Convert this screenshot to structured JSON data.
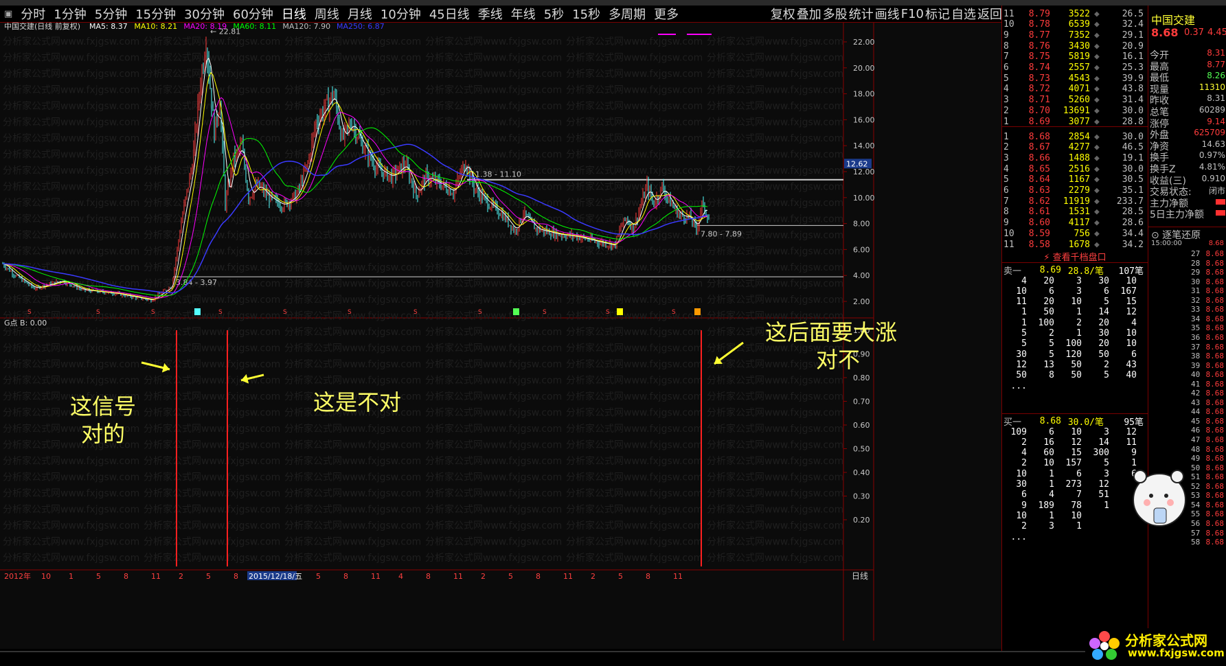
{
  "toolbar": {
    "periods": [
      "分时",
      "1分钟",
      "5分钟",
      "15分钟",
      "30分钟",
      "60分钟",
      "日线",
      "周线",
      "月线",
      "10分钟",
      "45日线",
      "季线",
      "年线",
      "5秒",
      "15秒",
      "多周期",
      "更多"
    ],
    "active": "日线",
    "right_items": [
      "复权",
      "叠加",
      "多股",
      "统计",
      "画线",
      "F10",
      "标记",
      "自选",
      "返回"
    ]
  },
  "main_chart": {
    "title": "中国交建(日线 前复权)",
    "indicators": [
      {
        "label": "MA5: 8.37",
        "color": "#ffffff"
      },
      {
        "label": "MA10: 8.21",
        "color": "#ffff00"
      },
      {
        "label": "MA20: 8.19",
        "color": "#ff00ff"
      },
      {
        "label": "MA60: 8.11",
        "color": "#00ff00"
      },
      {
        "label": "MA120: 7.90",
        "color": "#c0c0c0"
      },
      {
        "label": "MA250: 6.87",
        "color": "#3a3aff"
      }
    ],
    "y_ticks": [
      "22.00",
      "20.00",
      "18.00",
      "16.00",
      "14.00",
      "12.00",
      "10.00",
      "8.00",
      "6.00",
      "4.00",
      "2.00"
    ],
    "price_tag": "12.62",
    "peak_label": "22.81",
    "level_labels": [
      "11.38 - 11.10",
      "7.80 - 7.89",
      "3.84 - 3.97"
    ],
    "watermark": "分析家公式网www.fxjgsw.com"
  },
  "sub_chart": {
    "title": "G点  B: 0.00",
    "y_ticks": [
      "1.00",
      "0.90",
      "0.80",
      "0.70",
      "0.60",
      "0.50",
      "0.40",
      "0.30",
      "0.20"
    ]
  },
  "annotations": {
    "signal_correct": [
      "这信号",
      "对的"
    ],
    "signal_wrong": "这是不对",
    "question": [
      "这后面要大涨",
      "对不"
    ]
  },
  "x_axis": {
    "year": "2012年",
    "cursor_date": "2015/12/18/五",
    "labels": [
      "10",
      "1",
      "5",
      "8",
      "11",
      "2",
      "5",
      "8",
      "11",
      "2",
      "5",
      "8",
      "11",
      "4",
      "8",
      "11",
      "2",
      "5",
      "8",
      "11",
      "2",
      "5",
      "8",
      "11"
    ],
    "period": "日线"
  },
  "orderbook": {
    "asks": [
      {
        "n": "11",
        "price": "8.79",
        "vol": "3522",
        "pct": "26.5"
      },
      {
        "n": "10",
        "price": "8.78",
        "vol": "6539",
        "pct": "32.4"
      },
      {
        "n": "9",
        "price": "8.77",
        "vol": "7352",
        "pct": "29.1"
      },
      {
        "n": "8",
        "price": "8.76",
        "vol": "3430",
        "pct": "20.9"
      },
      {
        "n": "7",
        "price": "8.75",
        "vol": "5819",
        "pct": "16.1"
      },
      {
        "n": "6",
        "price": "8.74",
        "vol": "2557",
        "pct": "25.3"
      },
      {
        "n": "5",
        "price": "8.73",
        "vol": "4543",
        "pct": "39.9"
      },
      {
        "n": "4",
        "price": "8.72",
        "vol": "4071",
        "pct": "43.8"
      },
      {
        "n": "3",
        "price": "8.71",
        "vol": "5260",
        "pct": "31.4"
      },
      {
        "n": "2",
        "price": "8.70",
        "vol": "13691",
        "pct": "30.0"
      },
      {
        "n": "1",
        "price": "8.69",
        "vol": "3077",
        "pct": "28.8"
      }
    ],
    "bids": [
      {
        "n": "1",
        "price": "8.68",
        "vol": "2854",
        "pct": "30.0"
      },
      {
        "n": "2",
        "price": "8.67",
        "vol": "4277",
        "pct": "46.5"
      },
      {
        "n": "3",
        "price": "8.66",
        "vol": "1488",
        "pct": "19.1"
      },
      {
        "n": "4",
        "price": "8.65",
        "vol": "2516",
        "pct": "30.0"
      },
      {
        "n": "5",
        "price": "8.64",
        "vol": "1167",
        "pct": "30.5"
      },
      {
        "n": "6",
        "price": "8.63",
        "vol": "2279",
        "pct": "35.1"
      },
      {
        "n": "7",
        "price": "8.62",
        "vol": "11919",
        "pct": "233.7"
      },
      {
        "n": "8",
        "price": "8.61",
        "vol": "1531",
        "pct": "28.5"
      },
      {
        "n": "9",
        "price": "8.60",
        "vol": "4117",
        "pct": "28.6"
      },
      {
        "n": "10",
        "price": "8.59",
        "vol": "756",
        "pct": "34.4"
      },
      {
        "n": "11",
        "price": "8.58",
        "vol": "1678",
        "pct": "34.2"
      }
    ],
    "depth_button": "查看千档盘口",
    "sell1_header": {
      "label": "卖一",
      "price": "8.69",
      "avg": "28.8/笔",
      "count": "107笔"
    },
    "sell_queue": [
      [
        "4",
        "20",
        "3",
        "30",
        "10"
      ],
      [
        "10",
        "6",
        "3",
        "6",
        "167"
      ],
      [
        "11",
        "20",
        "10",
        "5",
        "15"
      ],
      [
        "1",
        "50",
        "1",
        "14",
        "12"
      ],
      [
        "1",
        "100",
        "2",
        "20",
        "4"
      ],
      [
        "5",
        "2",
        "1",
        "30",
        "10"
      ],
      [
        "5",
        "5",
        "100",
        "20",
        "10"
      ],
      [
        "30",
        "5",
        "120",
        "50",
        "6"
      ],
      [
        "12",
        "13",
        "50",
        "2",
        "43"
      ],
      [
        "50",
        "8",
        "50",
        "5",
        "40"
      ],
      [
        "...",
        "",
        "",
        "",
        ""
      ]
    ],
    "buy1_header": {
      "label": "买一",
      "price": "8.68",
      "avg": "30.0/笔",
      "count": "95笔"
    },
    "buy_queue": [
      [
        "109",
        "6",
        "10",
        "3",
        "12"
      ],
      [
        "2",
        "16",
        "12",
        "14",
        "11"
      ],
      [
        "4",
        "60",
        "15",
        "300",
        "9"
      ],
      [
        "2",
        "10",
        "157",
        "5",
        "1"
      ],
      [
        "10",
        "1",
        "6",
        "3",
        "6"
      ],
      [
        "30",
        "1",
        "273",
        "12",
        ""
      ],
      [
        "6",
        "4",
        "7",
        "51",
        ""
      ],
      [
        "9",
        "189",
        "78",
        "1",
        ""
      ],
      [
        "10",
        "1",
        "10",
        "",
        ""
      ],
      [
        "2",
        "3",
        "1",
        "",
        ""
      ],
      [
        "...",
        "",
        "",
        "",
        ""
      ]
    ]
  },
  "info_panel": {
    "stock_name": "中国交建",
    "price": "8.68",
    "change": "0.37",
    "change_pct": "4.45",
    "rows": [
      {
        "label": "今开",
        "value": "8.31"
      },
      {
        "label": "最高",
        "value": "8.77"
      },
      {
        "label": "最低",
        "value": "8.26"
      },
      {
        "label": "现量",
        "value": "11310"
      },
      {
        "label": "昨收",
        "value": "8.31"
      },
      {
        "label": "总笔",
        "value": "60289"
      },
      {
        "label": "涨停",
        "value": "9.14"
      },
      {
        "label": "外盘",
        "value": "625709"
      },
      {
        "label": "净资",
        "value": "14.63"
      },
      {
        "label": "换手",
        "value": "0.97%"
      },
      {
        "label": "换手Z",
        "value": "4.81%"
      },
      {
        "label": "收益(三)",
        "value": "0.910"
      },
      {
        "label": "交易状态:",
        "value": "闭市"
      },
      {
        "label": "主力净额",
        "value": ""
      },
      {
        "label": "5日主力净额",
        "value": ""
      }
    ],
    "tick_title": "逐笔还原",
    "tick_time": "15:00:00",
    "ticks": [
      {
        "s": "27",
        "p": "8.68"
      },
      {
        "s": "28",
        "p": "8.68"
      },
      {
        "s": "29",
        "p": "8.68"
      },
      {
        "s": "30",
        "p": "8.68"
      },
      {
        "s": "31",
        "p": "8.68"
      },
      {
        "s": "32",
        "p": "8.68"
      },
      {
        "s": "33",
        "p": "8.68"
      },
      {
        "s": "34",
        "p": "8.68"
      },
      {
        "s": "35",
        "p": "8.68"
      },
      {
        "s": "36",
        "p": "8.68"
      },
      {
        "s": "37",
        "p": "8.68"
      },
      {
        "s": "38",
        "p": "8.68"
      },
      {
        "s": "39",
        "p": "8.68"
      },
      {
        "s": "40",
        "p": "8.68"
      },
      {
        "s": "41",
        "p": "8.68"
      },
      {
        "s": "42",
        "p": "8.68"
      },
      {
        "s": "43",
        "p": "8.68"
      },
      {
        "s": "44",
        "p": "8.68"
      },
      {
        "s": "45",
        "p": "8.68"
      },
      {
        "s": "46",
        "p": "8.68"
      },
      {
        "s": "47",
        "p": "8.68"
      },
      {
        "s": "48",
        "p": "8.68"
      },
      {
        "s": "49",
        "p": "8.68"
      },
      {
        "s": "50",
        "p": "8.68"
      },
      {
        "s": "51",
        "p": "8.68"
      },
      {
        "s": "52",
        "p": "8.68"
      },
      {
        "s": "53",
        "p": "8.68"
      },
      {
        "s": "54",
        "p": "8.68"
      },
      {
        "s": "55",
        "p": "8.68"
      },
      {
        "s": "56",
        "p": "8.68"
      },
      {
        "s": "57",
        "p": "8.68"
      },
      {
        "s": "58",
        "p": "8.68"
      }
    ]
  },
  "logo": {
    "line1": "分析家公式网",
    "line2": "www.fxjgsw.com"
  },
  "colors": {
    "up": "#ff3c3c",
    "down": "#54ff54",
    "accent": "#ff0000",
    "yellow": "#ffff00"
  }
}
